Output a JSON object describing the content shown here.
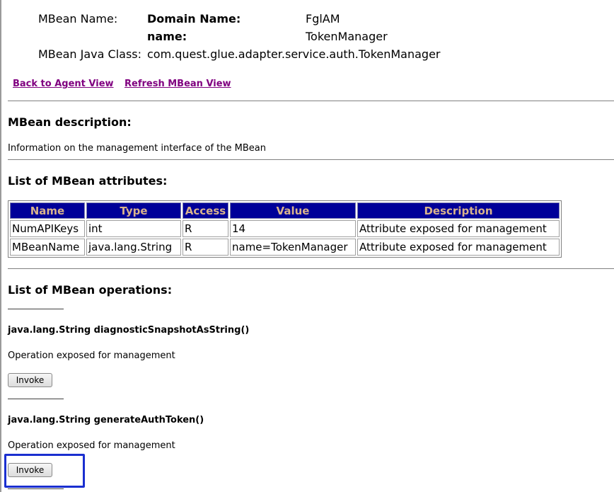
{
  "header": {
    "mbean_name_label": "MBean Name:",
    "domain_name_label": "Domain Name:",
    "domain_name_value": "FglAM",
    "name_label": "name:",
    "name_value": "TokenManager",
    "java_class_label": "MBean Java Class:",
    "java_class_value": "com.quest.glue.adapter.service.auth.TokenManager"
  },
  "links": {
    "back": "Back to Agent View",
    "refresh": "Refresh MBean View"
  },
  "description": {
    "heading": "MBean description:",
    "text": "Information on the management interface of the MBean"
  },
  "attributes": {
    "heading": "List of MBean attributes:",
    "columns": [
      "Name",
      "Type",
      "Access",
      "Value",
      "Description"
    ],
    "rows": [
      [
        "NumAPIKeys",
        "int",
        "R",
        "14",
        "Attribute exposed for management"
      ],
      [
        "MBeanName",
        "java.lang.String",
        "R",
        "name=TokenManager",
        "Attribute exposed for management"
      ]
    ]
  },
  "operations": {
    "heading": "List of MBean operations:",
    "items": [
      {
        "signature": "java.lang.String diagnosticSnapshotAsString()",
        "description": "Operation exposed for management",
        "button": "Invoke"
      },
      {
        "signature": "java.lang.String generateAuthToken()",
        "description": "Operation exposed for management",
        "button": "Invoke"
      }
    ]
  },
  "colors": {
    "table_header_bg": "#000099",
    "table_header_text": "#d9b38c",
    "visited_link": "#800080",
    "highlight_box": "#1a2fd0"
  }
}
